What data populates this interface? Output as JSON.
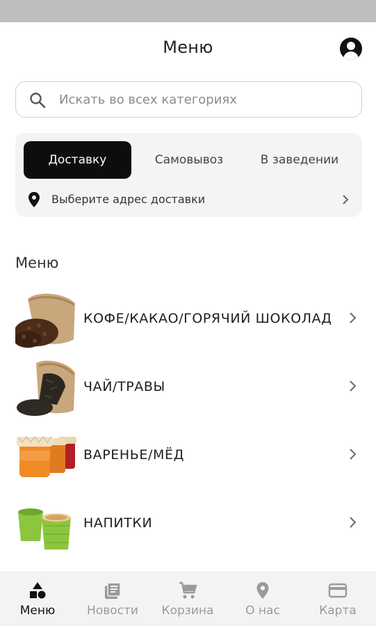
{
  "header": {
    "title": "Меню"
  },
  "search": {
    "placeholder": "Искать во всех категориях"
  },
  "delivery": {
    "tabs": [
      {
        "label": "Доставку",
        "active": true
      },
      {
        "label": "Самовывоз",
        "active": false
      },
      {
        "label": "В заведении",
        "active": false
      }
    ],
    "address_label": "Выберите адрес доставки"
  },
  "menu": {
    "section_title": "Меню",
    "categories": [
      {
        "label": "КОФЕ/КАКАО/ГОРЯЧИЙ ШОКОЛАД",
        "image": "coffee-beans-sack"
      },
      {
        "label": "ЧАЙ/ТРАВЫ",
        "image": "tea-leaves-sack"
      },
      {
        "label": "ВАРЕНЬЕ/МЁД",
        "image": "jam-jars"
      },
      {
        "label": "НАПИТКИ",
        "image": "green-cups"
      }
    ]
  },
  "bottom_nav": {
    "items": [
      {
        "label": "Меню",
        "icon": "shapes-icon",
        "active": true
      },
      {
        "label": "Новости",
        "icon": "news-icon",
        "active": false
      },
      {
        "label": "Корзина",
        "icon": "cart-icon",
        "active": false
      },
      {
        "label": "О нас",
        "icon": "location-pin-icon",
        "active": false
      },
      {
        "label": "Карта",
        "icon": "credit-card-icon",
        "active": false
      }
    ]
  },
  "colors": {
    "accent": "#0d0d0d",
    "status_bar": "#bdbdbd",
    "card_background": "#f4f4f4",
    "nav_inactive": "#9a9a9a"
  }
}
